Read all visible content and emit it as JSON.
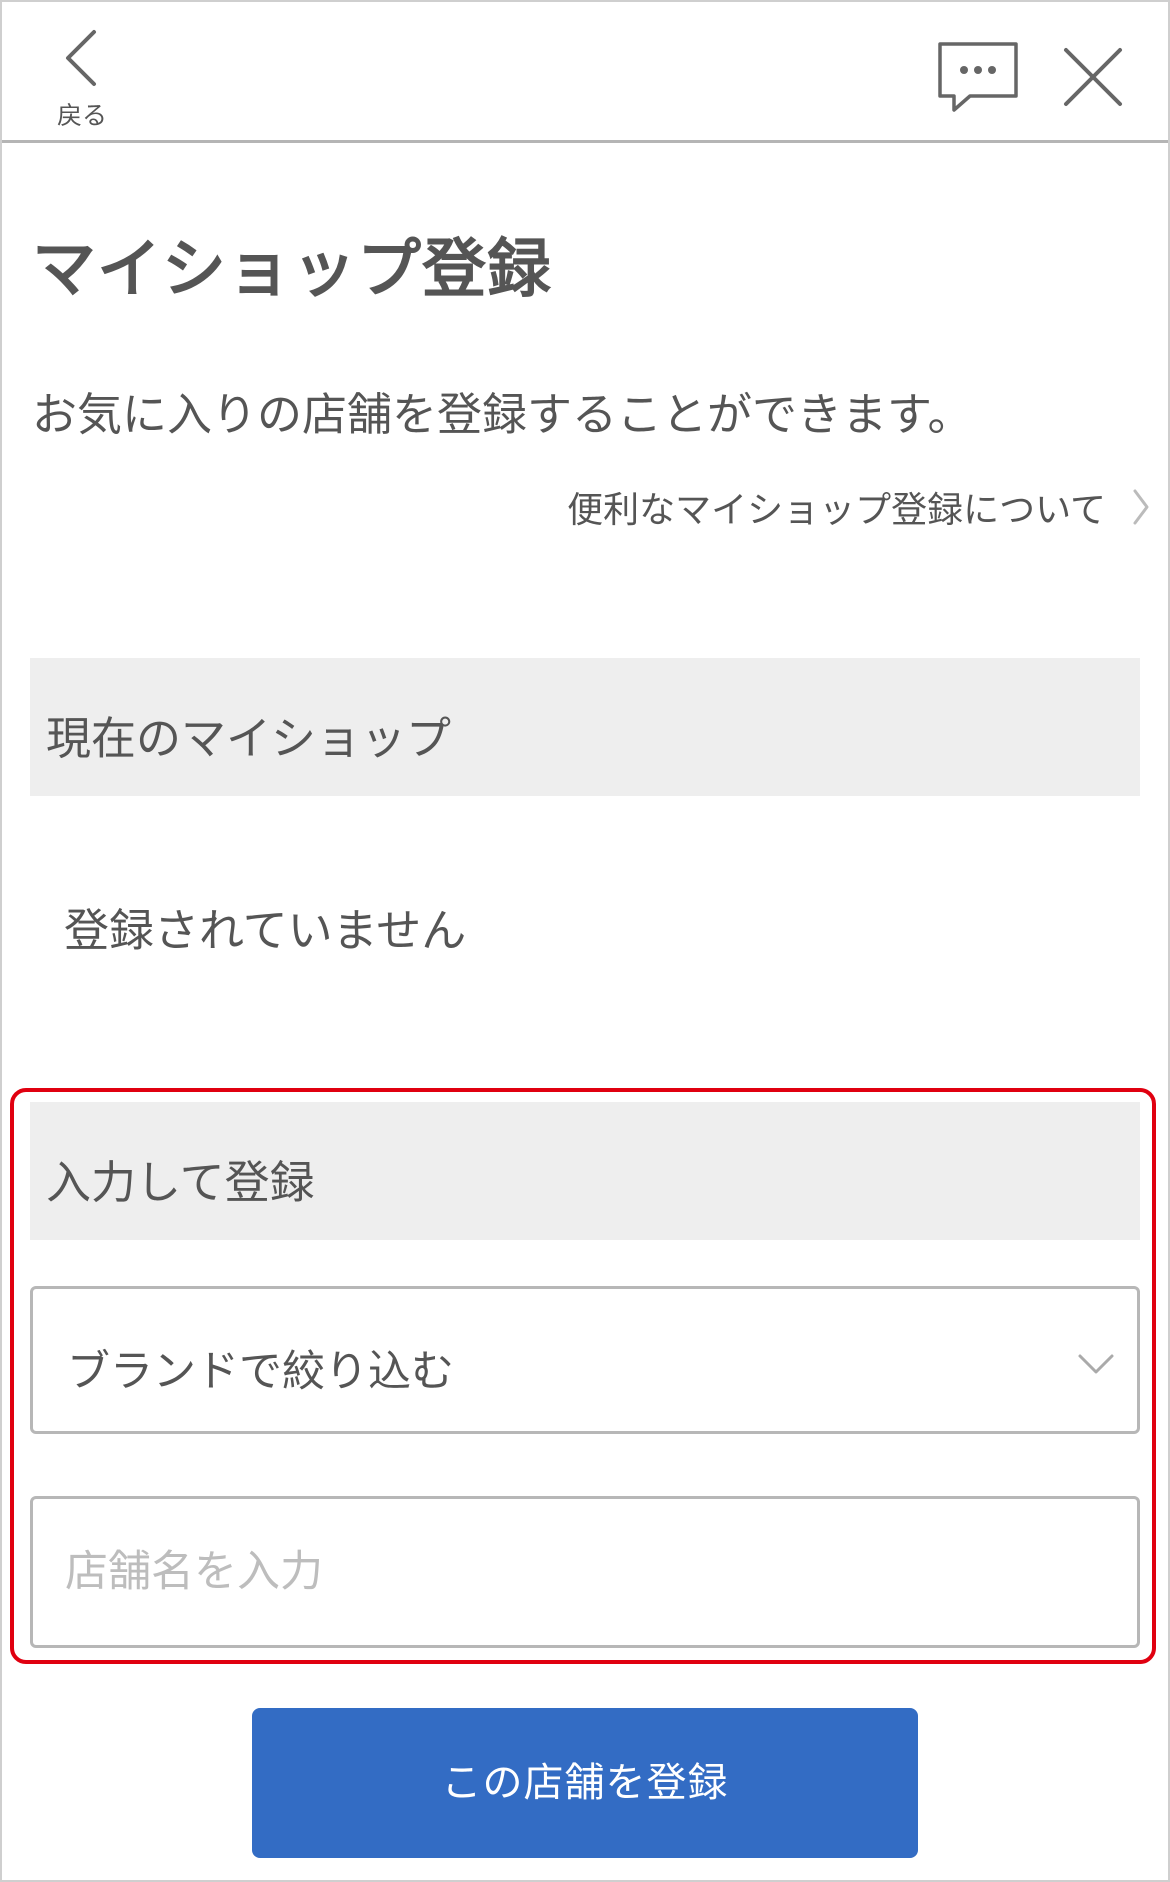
{
  "header": {
    "back_label": "戻る",
    "icons": [
      "chevron-left-icon",
      "chat-bubble-icon",
      "close-icon"
    ]
  },
  "main": {
    "title": "マイショップ登録",
    "description": "お気に入りの店舗を登録することができます。",
    "about_link": "便利なマイショップ登録について",
    "current_section": {
      "title": "現在のマイショップ",
      "status": "登録されていません"
    },
    "input_section": {
      "title": "入力して登録",
      "brand_select": {
        "value": "ブランドで絞り込む"
      },
      "store_input": {
        "value": "",
        "placeholder": "店舗名を入力"
      }
    },
    "register_button_label": "この店舗を登録"
  },
  "colors": {
    "accent": "#336cc4",
    "highlight": "#e00010",
    "section_bg": "#eeeeee",
    "text": "#555555"
  }
}
